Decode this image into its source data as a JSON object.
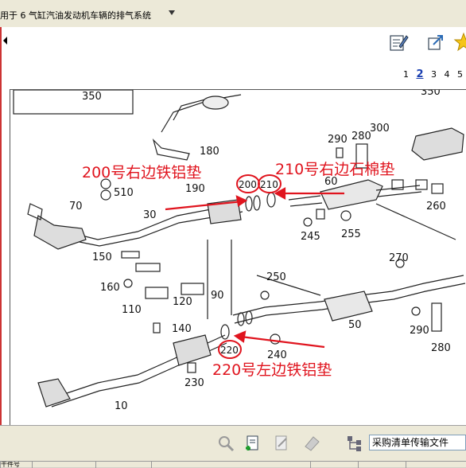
{
  "window": {
    "title": "用于 6 气缸汽油发动机车辆的排气系统"
  },
  "toolbar": {
    "icons": [
      "edit-notes-icon",
      "external-link-icon",
      "star-favorite-icon"
    ]
  },
  "pagination": {
    "pages": [
      "1",
      "2",
      "3",
      "4",
      "5"
    ],
    "current": "2"
  },
  "diagram": {
    "annotations": {
      "a200": "200号右边铁铝垫",
      "a210": "210号右边石棉垫",
      "a220": "220号左边铁铝垫"
    },
    "circled_parts": [
      "200",
      "210",
      "220"
    ],
    "part_numbers": {
      "p350": "350",
      "p350b": "350",
      "p180": "180",
      "p190": "190",
      "p510": "510",
      "p70": "70",
      "p30": "30",
      "p150": "150",
      "p160": "160",
      "p110": "110",
      "p120": "120",
      "p90": "90",
      "p140": "140",
      "p230": "230",
      "p10": "10",
      "p290": "290",
      "p280": "280",
      "p300": "300",
      "p60": "60",
      "p245": "245",
      "p255": "255",
      "p260": "260",
      "p250": "250",
      "p270": "270",
      "p240": "240",
      "p50": "50",
      "p290b": "290",
      "p280b": "280"
    }
  },
  "bottom_toolbar": {
    "icons": [
      "search-parts-icon",
      "add-document-icon",
      "document-icon",
      "eraser-icon",
      "tree-structure-icon"
    ],
    "combo_value": "采购清单传输文件"
  },
  "status_columns": [
    "干件号",
    "",
    "",
    "",
    "",
    "",
    ""
  ],
  "colors": {
    "annotation_red": "#e0141e",
    "page_current": "#1a3fb0"
  }
}
